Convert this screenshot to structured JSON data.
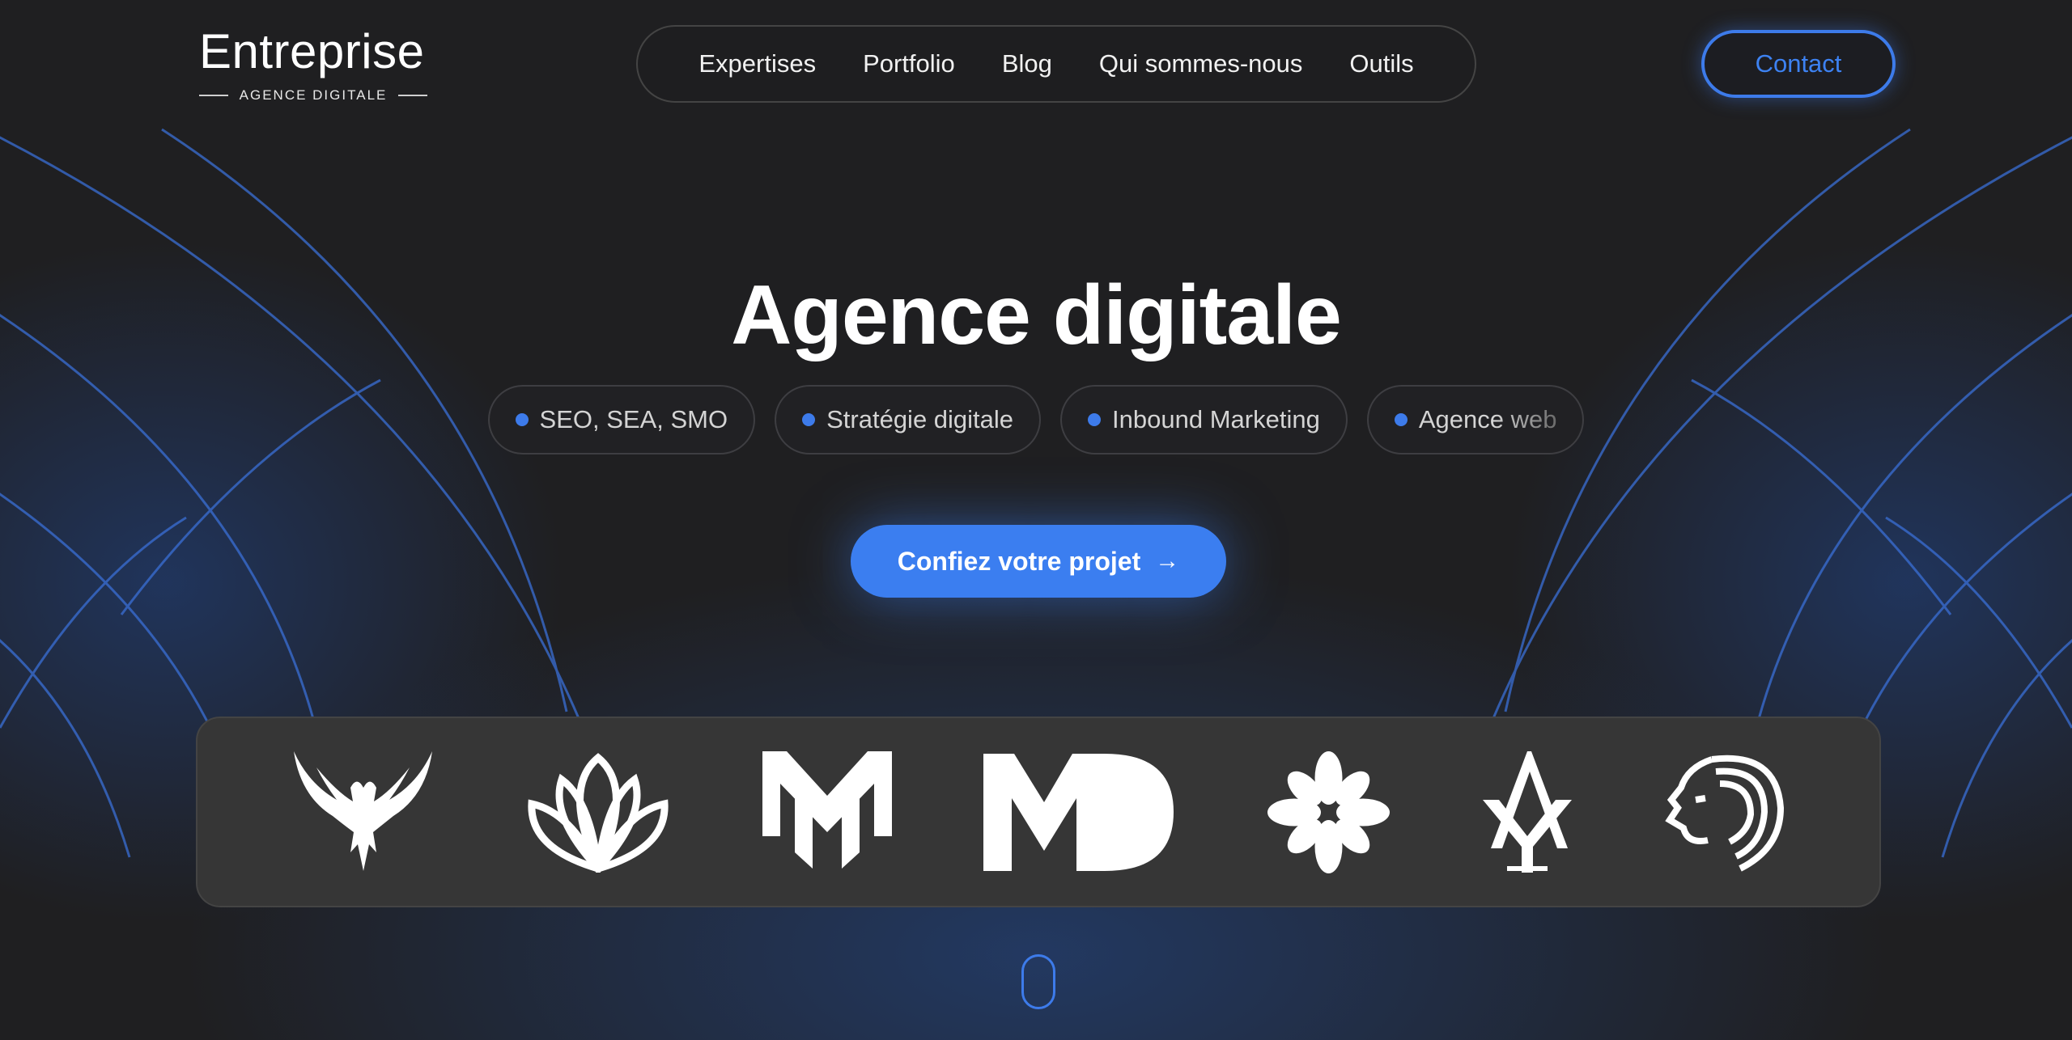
{
  "header": {
    "logo_name": "Entreprise",
    "logo_tagline": "AGENCE DIGITALE",
    "nav": [
      "Expertises",
      "Portfolio",
      "Blog",
      "Qui sommes-nous",
      "Outils"
    ],
    "contact_label": "Contact"
  },
  "hero": {
    "title": "Agence digitale",
    "tags": [
      "SEO, SEA, SMO",
      "Stratégie digitale",
      "Inbound Marketing",
      "Agence web"
    ],
    "cta_label": "Confiez votre projet",
    "cta_icon": "arrow-right-icon"
  },
  "client_logos": [
    "eagle-logo",
    "lotus-logo",
    "mm-monogram-logo",
    "md-monogram-logo",
    "flower-logo",
    "ay-monogram-logo",
    "lion-logo"
  ],
  "colors": {
    "accent": "#3b7ef0",
    "background": "#1f1f21",
    "strip": "#363636"
  }
}
